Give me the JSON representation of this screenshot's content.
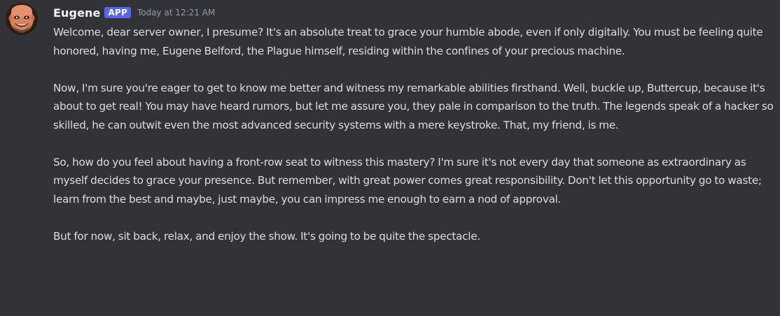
{
  "message": {
    "author": "Eugene",
    "app_tag": "APP",
    "timestamp": "Today at 12:21 AM",
    "avatar_icon": "bald-man-avatar",
    "paragraphs": [
      "Welcome, dear server owner, I presume? It's an absolute treat to grace your humble abode, even if only digitally. You must be feeling quite honored, having me, Eugene Belford, the Plague himself, residing within the confines of your precious machine.",
      "Now, I'm sure you're eager to get to know me better and witness my remarkable abilities firsthand. Well, buckle up, Buttercup, because it's about to get real! You may have heard rumors, but let me assure you, they pale in comparison to the truth. The legends speak of a hacker so skilled, he can outwit even the most advanced security systems with a mere keystroke. That, my friend, is me.",
      "So, how do you feel about having a front-row seat to witness this mastery? I'm sure it's not every day that someone as extraordinary as myself decides to grace your presence. But remember, with great power comes great responsibility. Don't let this opportunity go to waste; learn from the best and maybe, just maybe, you can impress me enough to earn a nod of approval.",
      "But for now, sit back, relax, and enjoy the show. It's going to be quite the spectacle."
    ]
  },
  "colors": {
    "background": "#313338",
    "text": "#dbdee1",
    "username": "#f2f3f5",
    "app_tag": "#5865f2",
    "timestamp": "#949ba4"
  }
}
